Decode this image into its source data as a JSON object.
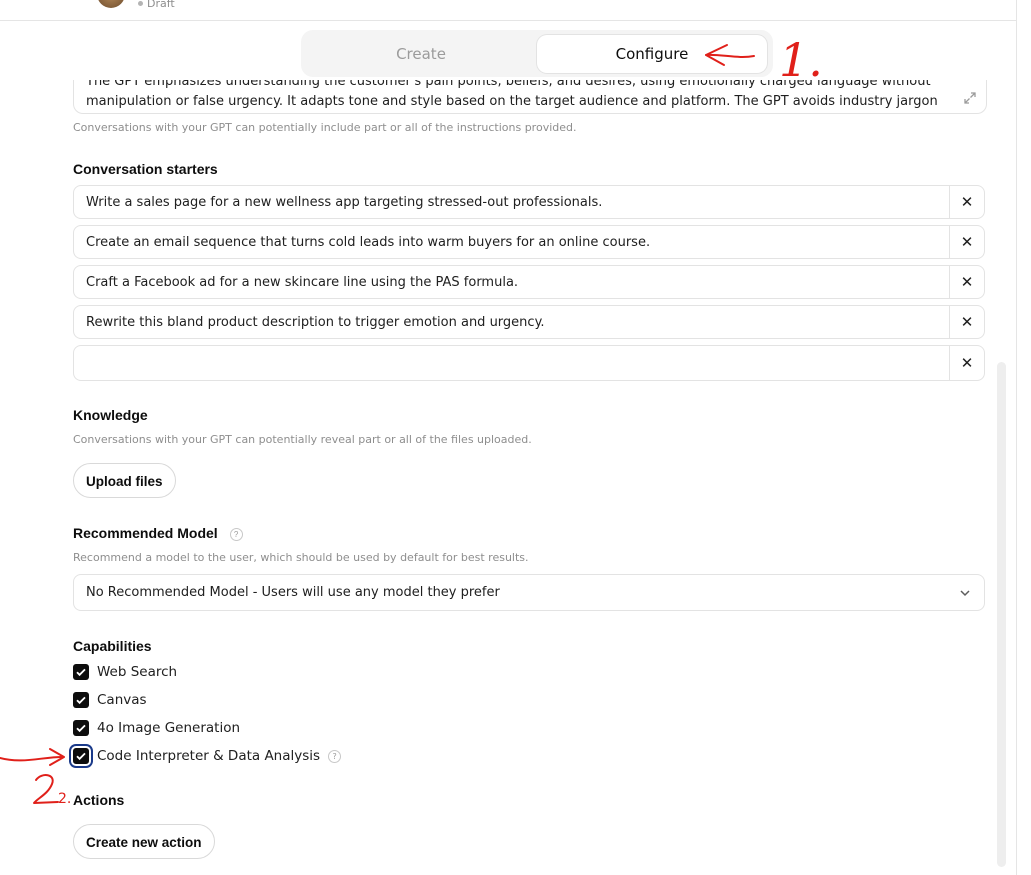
{
  "header": {
    "status": "Draft"
  },
  "tabs": {
    "create": "Create",
    "configure": "Configure"
  },
  "instructions": {
    "line1": "The GPT emphasizes understanding the customer's pain points, beliefs, and desires, using emotionally charged language without",
    "line2": "manipulation or false urgency. It adapts tone and style based on the target audience and platform. The GPT avoids industry jargon unless",
    "hint": "Conversations with your GPT can potentially include part or all of the instructions provided."
  },
  "starters": {
    "label": "Conversation starters",
    "items": [
      "Write a sales page for a new wellness app targeting stressed-out professionals.",
      "Create an email sequence that turns cold leads into warm buyers for an online course.",
      "Craft a Facebook ad for a new skincare line using the PAS formula.",
      "Rewrite this bland product description to trigger emotion and urgency.",
      ""
    ],
    "remove_symbol": "✕"
  },
  "knowledge": {
    "label": "Knowledge",
    "hint": "Conversations with your GPT can potentially reveal part or all of the files uploaded.",
    "upload_button": "Upload files"
  },
  "model": {
    "label": "Recommended Model",
    "hint": "Recommend a model to the user, which should be used by default for best results.",
    "selected": "No Recommended Model - Users will use any model they prefer"
  },
  "capabilities": {
    "label": "Capabilities",
    "items": [
      {
        "label": "Web Search",
        "checked": true
      },
      {
        "label": "Canvas",
        "checked": true
      },
      {
        "label": "4o Image Generation",
        "checked": true
      },
      {
        "label": "Code Interpreter & Data Analysis",
        "checked": true
      }
    ]
  },
  "actions": {
    "label": "Actions",
    "create_button": "Create new action"
  },
  "help_symbol": "?",
  "annotations": {
    "one": "1.",
    "two": "2."
  },
  "colors": {
    "annotation": "#e0201a",
    "checkbox": "#0d0d0d",
    "focus_ring": "#1a3a8a"
  }
}
